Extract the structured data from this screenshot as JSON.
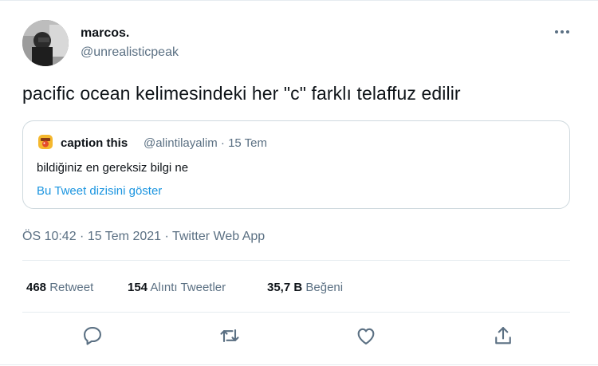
{
  "author": {
    "name": "marcos.",
    "handle": "@unrealisticpeak",
    "avatar_icon": "profile-photo"
  },
  "tweet": {
    "text": "pacific ocean kelimesindeki her \"c\" farklı telaffuz edilir",
    "timestamp": "ÖS 10:42 · 15 Tem 2021 · Twitter Web App"
  },
  "quoted": {
    "name": "caption this",
    "handle_date": "@alintilayalim · 15 Tem",
    "text": "bildiğiniz en gereksiz bilgi ne",
    "thread_link": "Bu Tweet dizisini göster",
    "avatar_icon": "emoji-avatar"
  },
  "stats": {
    "retweets_count": "468",
    "retweets_label": "Retweet",
    "quotes_count": "154",
    "quotes_label": "Alıntı Tweetler",
    "likes_count": "35,7 B",
    "likes_label": "Beğeni"
  },
  "actions": [
    "reply-icon",
    "retweet-icon",
    "like-icon",
    "share-icon"
  ],
  "colors": {
    "text": "#0f1419",
    "secondary": "#5b7083",
    "link": "#1b95e0",
    "border": "#cfd9de"
  }
}
